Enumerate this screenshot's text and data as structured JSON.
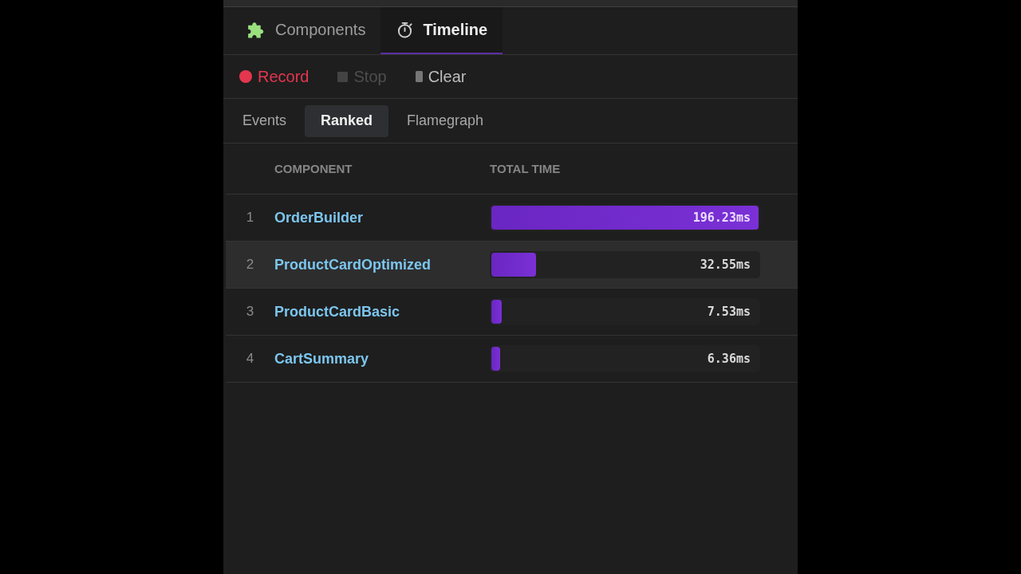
{
  "main_tabs": [
    {
      "label": "Components",
      "kind": "puzzle",
      "selected": false
    },
    {
      "label": "Timeline",
      "kind": "stopwatch",
      "selected": true
    }
  ],
  "toolbar": [
    {
      "label": "Record",
      "kind": "record",
      "disabled": false
    },
    {
      "label": "Stop",
      "kind": "stop",
      "disabled": true
    },
    {
      "label": "Clear",
      "kind": "clear",
      "disabled": false
    }
  ],
  "view_tabs": [
    {
      "label": "Events",
      "selected": false
    },
    {
      "label": "Ranked",
      "selected": true
    },
    {
      "label": "Flamegraph",
      "selected": false
    }
  ],
  "table": {
    "columns": [
      "COMPONENT",
      "TOTAL TIME"
    ],
    "rows": [
      {
        "rank": "1",
        "name": "OrderBuilder",
        "time": "196.23ms",
        "level": 1,
        "selected": false
      },
      {
        "rank": "2",
        "name": "ProductCardOptimized",
        "time": "32.55ms",
        "level": 0.166,
        "selected": true
      },
      {
        "rank": "3",
        "name": "ProductCardBasic",
        "time": "7.53ms",
        "level": 0.038,
        "selected": false
      },
      {
        "rank": "4",
        "name": "CartSummary",
        "time": "6.36ms",
        "level": 0.032,
        "selected": false
      }
    ]
  }
}
